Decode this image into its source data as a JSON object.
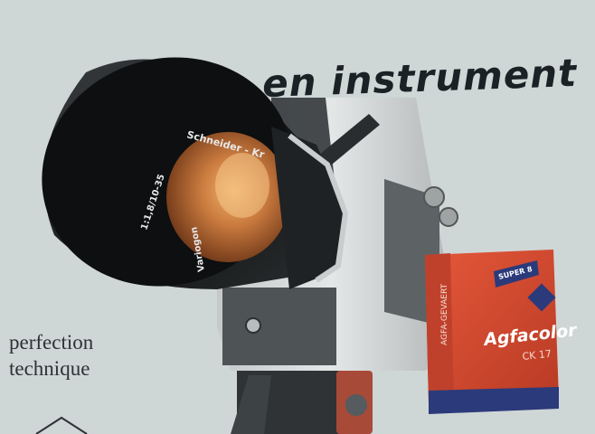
{
  "headline": "en instrument",
  "caption_line1": "perfection",
  "caption_line2": "technique",
  "lens": {
    "brand": "Schneider - Kr",
    "spec": "1:1,8/10-35",
    "model": "Variogon",
    "maker_fragment": "Kreuznach"
  },
  "film_box": {
    "badge": "SUPER 8",
    "side_label": "AGFA-GEVAERT",
    "brand": "Agfacolor",
    "type": "CK 17"
  },
  "colors": {
    "background": "#cfd6d6",
    "camera_body": "#d9dcdc",
    "camera_dark": "#4e5356",
    "lens_glass": "#c97a3e",
    "box_red": "#d5422a",
    "box_navy": "#2b3a7a"
  }
}
